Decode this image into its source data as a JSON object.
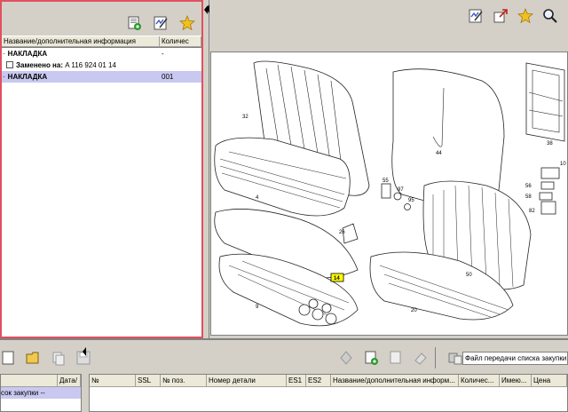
{
  "left_panel": {
    "columns": [
      "Название/дополнительная информация",
      "Количес"
    ],
    "rows": [
      {
        "name": "НАКЛАДКА",
        "qty": "-",
        "bold": true,
        "selected": false,
        "checkbox": false
      },
      {
        "name": "Заменено на: A 116 924 01 14",
        "qty": "",
        "bold": false,
        "selected": false,
        "checkbox": true
      },
      {
        "name": "НАКЛАДКА",
        "qty": "001",
        "bold": true,
        "selected": true,
        "checkbox": false
      }
    ],
    "toolbar_icons": [
      "add-to-list-icon",
      "edit-note-icon",
      "favorite-star-icon"
    ]
  },
  "right_panel": {
    "toolbar_icons": [
      "edit-note-icon",
      "zoom-window-icon",
      "favorite-star-icon",
      "search-icon"
    ],
    "part_labels": [
      "32",
      "44",
      "38",
      "4",
      "55",
      "97",
      "95",
      "10",
      "56",
      "58",
      "82",
      "26",
      "14",
      "9",
      "50",
      "20"
    ]
  },
  "bottom_panel": {
    "left_columns": [
      "Дата/"
    ],
    "left_row": "сок закупки --",
    "transfer_label": "Файл передачи списка закупки",
    "columns": [
      "№",
      "SSL",
      "№ поз.",
      "Номер детали",
      "ES1",
      "ES2",
      "Название/дополнительная информ...",
      "Количес...",
      "Имею...",
      "Цена"
    ]
  },
  "colors": {
    "selection": "#c8c8f0",
    "active_border": "#e05060",
    "star": "#f0c020"
  }
}
